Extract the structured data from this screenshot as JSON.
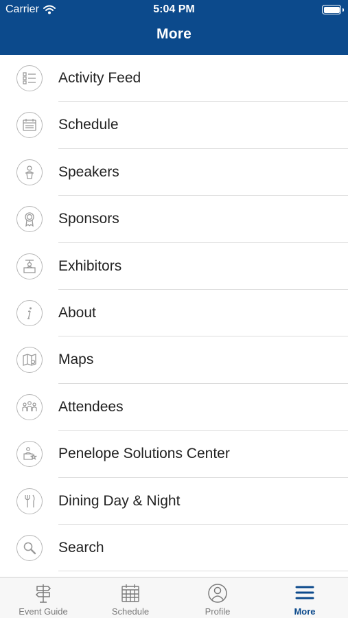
{
  "status_bar": {
    "carrier": "Carrier",
    "time": "5:04 PM"
  },
  "nav": {
    "title": "More"
  },
  "menu": {
    "items": [
      {
        "label": "Activity Feed",
        "icon": "activity-feed-icon"
      },
      {
        "label": "Schedule",
        "icon": "schedule-icon"
      },
      {
        "label": "Speakers",
        "icon": "speakers-icon"
      },
      {
        "label": "Sponsors",
        "icon": "sponsors-icon"
      },
      {
        "label": "Exhibitors",
        "icon": "exhibitors-icon"
      },
      {
        "label": "About",
        "icon": "info-icon"
      },
      {
        "label": "Maps",
        "icon": "map-icon"
      },
      {
        "label": "Attendees",
        "icon": "attendees-icon"
      },
      {
        "label": "Penelope Solutions Center",
        "icon": "solutions-center-icon"
      },
      {
        "label": "Dining Day & Night",
        "icon": "dining-icon"
      },
      {
        "label": "Search",
        "icon": "search-icon"
      }
    ]
  },
  "tab_bar": {
    "tabs": [
      {
        "label": "Event Guide",
        "icon": "signpost-icon"
      },
      {
        "label": "Schedule",
        "icon": "calendar-icon"
      },
      {
        "label": "Profile",
        "icon": "profile-icon"
      },
      {
        "label": "More",
        "icon": "hamburger-icon",
        "active": true
      }
    ]
  },
  "colors": {
    "primary": "#0c4a8c",
    "icon_gray": "#9a9a9a",
    "separator": "#dcdcdc"
  }
}
